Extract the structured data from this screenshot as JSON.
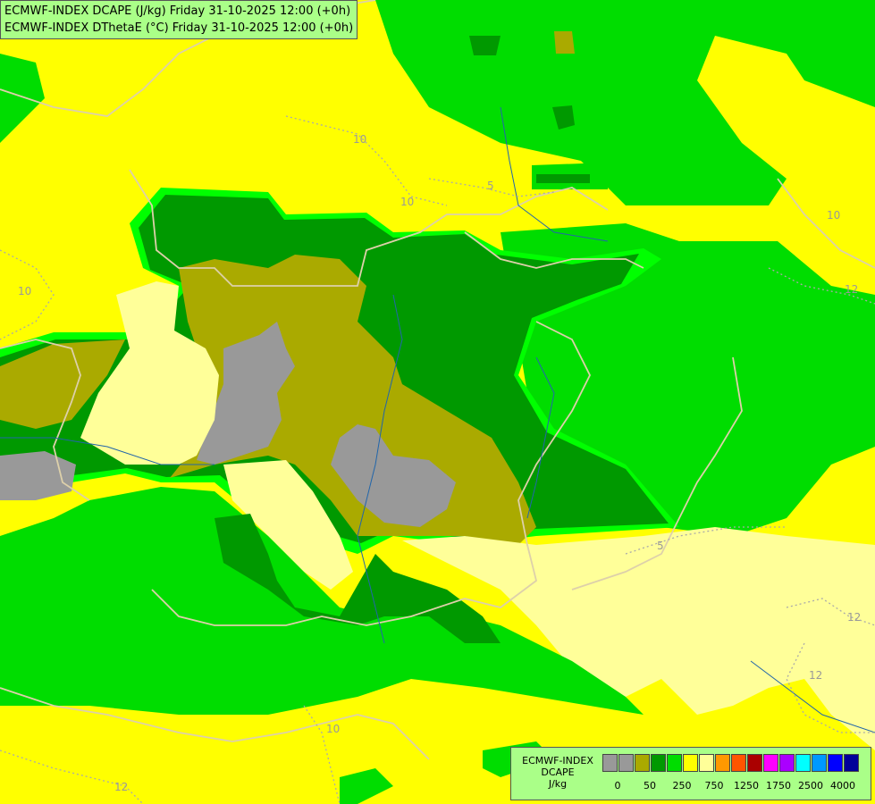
{
  "header": {
    "line1": "ECMWF-INDEX DCAPE (J/kg) Friday 31-10-2025 12:00 (+0h)",
    "line2": "ECMWF-INDEX DThetaE (°C) Friday 31-10-2025 12:00 (+0h)"
  },
  "legend": {
    "line1": "ECMWF-INDEX",
    "line2": "DCAPE",
    "line3": "J/kg",
    "colors": [
      "#999999",
      "#999999",
      "#aaaa00",
      "#009900",
      "#00dd00",
      "#ffff00",
      "#ffff99",
      "#ff9900",
      "#ff5500",
      "#aa0000",
      "#ff00ff",
      "#aa00ff",
      "#00ffff",
      "#0099ff",
      "#0000ff",
      "#000099"
    ],
    "ticks": [
      "0",
      "50",
      "250",
      "750",
      "1250",
      "1750",
      "2500",
      "4000"
    ]
  },
  "contour_labels": [
    "10",
    "5",
    "10",
    "10",
    "12",
    "10",
    "12",
    "12",
    "5",
    "10",
    "12"
  ],
  "colors": {
    "grey": "#999999",
    "olive": "#aaaa00",
    "dark_green": "#009900",
    "green": "#00dd00",
    "light_green": "#00ff00",
    "yellow": "#ffff00",
    "pale_yellow": "#ffff99"
  }
}
